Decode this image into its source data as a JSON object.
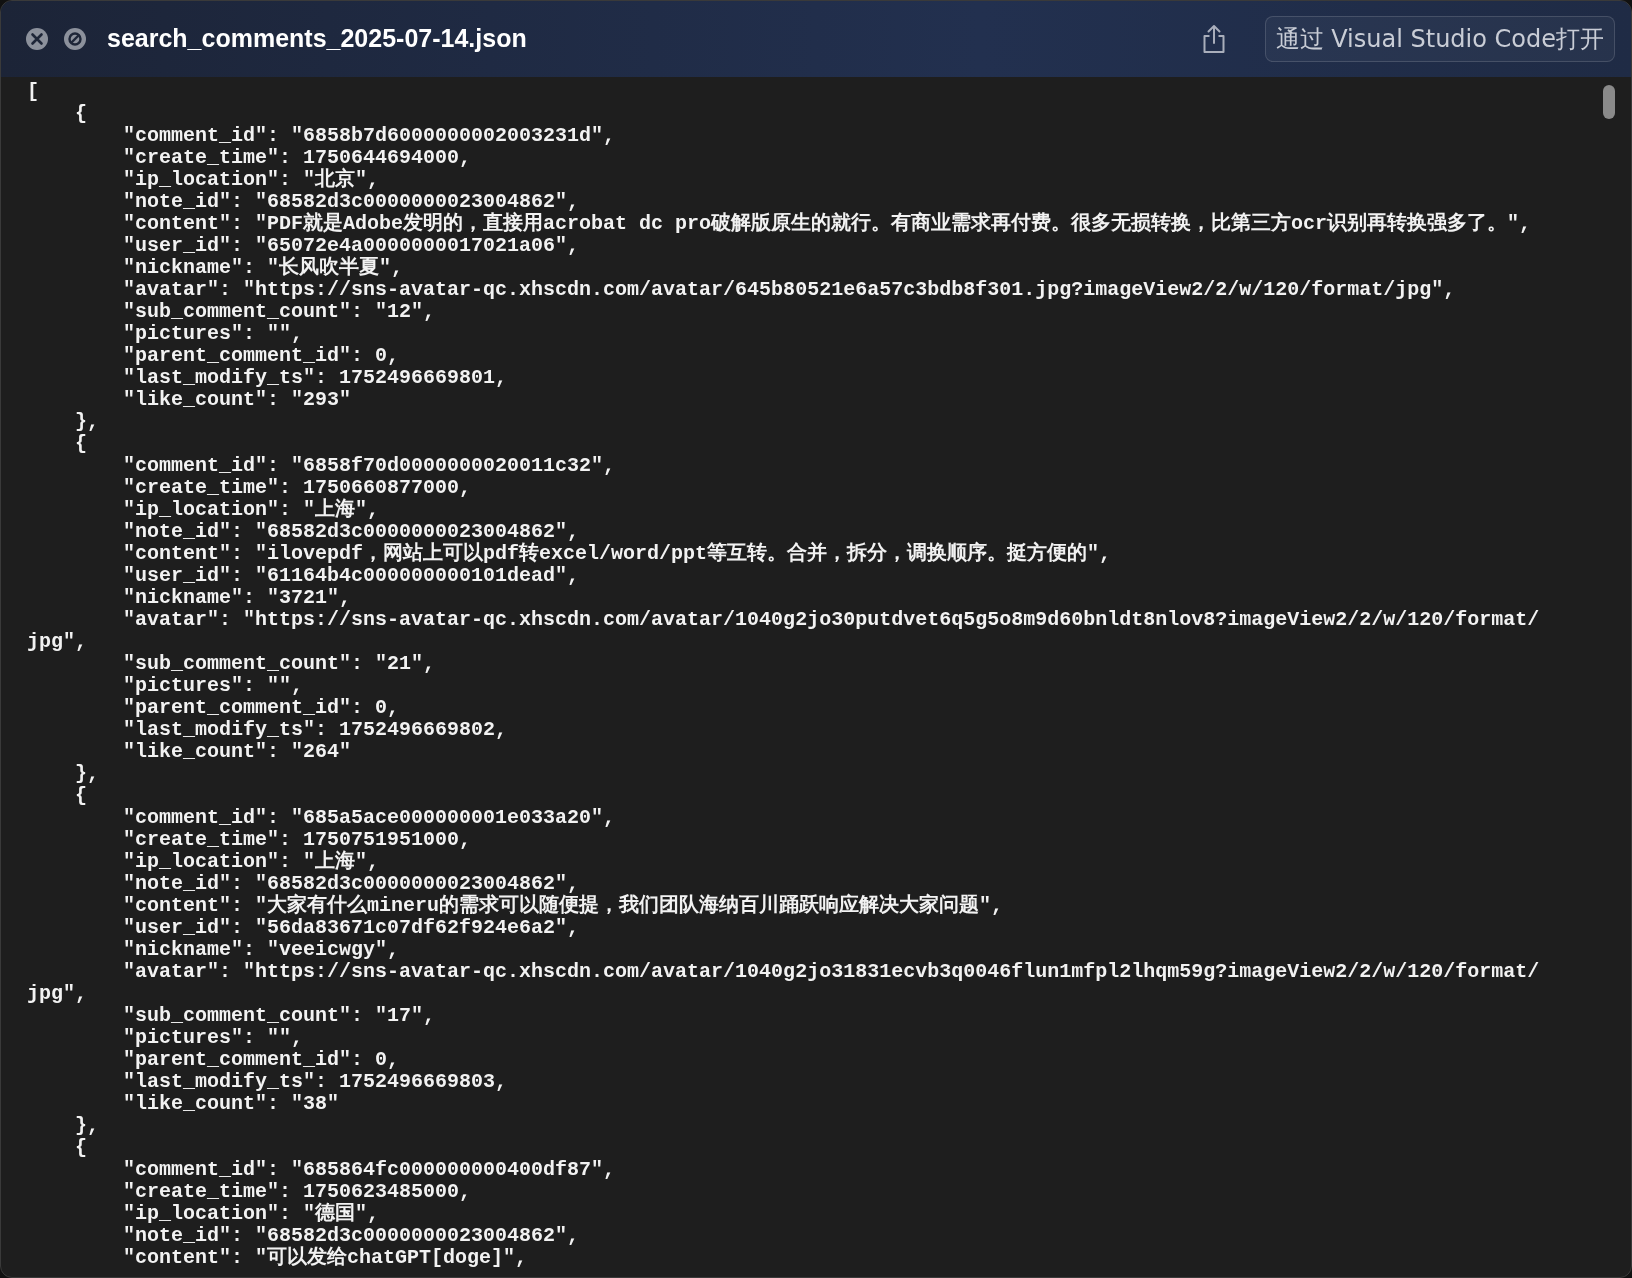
{
  "window": {
    "title": "search_comments_2025-07-14.json",
    "open_button": "通过 Visual Studio Code打开"
  },
  "lines": [
    "[",
    "    {",
    "        \"comment_id\": \"6858b7d6000000002003231d\",",
    "        \"create_time\": 1750644694000,",
    "        \"ip_location\": \"北京\",",
    "        \"note_id\": \"68582d3c0000000023004862\",",
    "        \"content\": \"PDF就是Adobe发明的，直接用acrobat dc pro破解版原生的就行。有商业需求再付费。很多无损转换，比第三方ocr识别再转换强多了。\",",
    "        \"user_id\": \"65072e4a0000000017021a06\",",
    "        \"nickname\": \"长风吹半夏\",",
    "        \"avatar\": \"https://sns-avatar-qc.xhscdn.com/avatar/645b80521e6a57c3bdb8f301.jpg?imageView2/2/w/120/format/jpg\",",
    "        \"sub_comment_count\": \"12\",",
    "        \"pictures\": \"\",",
    "        \"parent_comment_id\": 0,",
    "        \"last_modify_ts\": 1752496669801,",
    "        \"like_count\": \"293\"",
    "    },",
    "    {",
    "        \"comment_id\": \"6858f70d0000000020011c32\",",
    "        \"create_time\": 1750660877000,",
    "        \"ip_location\": \"上海\",",
    "        \"note_id\": \"68582d3c0000000023004862\",",
    "        \"content\": \"ilovepdf，网站上可以pdf转excel/word/ppt等互转。合并，拆分，调换顺序。挺方便的\",",
    "        \"user_id\": \"61164b4c000000000101dead\",",
    "        \"nickname\": \"3721\",",
    "        \"avatar\": \"https://sns-avatar-qc.xhscdn.com/avatar/1040g2jo30putdvet6q5g5o8m9d60bnldt8nlov8?imageView2/2/w/120/format/",
    "jpg\",",
    "        \"sub_comment_count\": \"21\",",
    "        \"pictures\": \"\",",
    "        \"parent_comment_id\": 0,",
    "        \"last_modify_ts\": 1752496669802,",
    "        \"like_count\": \"264\"",
    "    },",
    "    {",
    "        \"comment_id\": \"685a5ace000000001e033a20\",",
    "        \"create_time\": 1750751951000,",
    "        \"ip_location\": \"上海\",",
    "        \"note_id\": \"68582d3c0000000023004862\",",
    "        \"content\": \"大家有什么mineru的需求可以随便提，我们团队海纳百川踊跃响应解决大家问题\",",
    "        \"user_id\": \"56da83671c07df62f924e6a2\",",
    "        \"nickname\": \"veeicwgy\",",
    "        \"avatar\": \"https://sns-avatar-qc.xhscdn.com/avatar/1040g2jo31831ecvb3q0046flun1mfpl2lhqm59g?imageView2/2/w/120/format/",
    "jpg\",",
    "        \"sub_comment_count\": \"17\",",
    "        \"pictures\": \"\",",
    "        \"parent_comment_id\": 0,",
    "        \"last_modify_ts\": 1752496669803,",
    "        \"like_count\": \"38\"",
    "    },",
    "    {",
    "        \"comment_id\": \"685864fc000000000400df87\",",
    "        \"create_time\": 1750623485000,",
    "        \"ip_location\": \"德国\",",
    "        \"note_id\": \"68582d3c0000000023004862\",",
    "        \"content\": \"可以发给chatGPT[doge]\","
  ]
}
